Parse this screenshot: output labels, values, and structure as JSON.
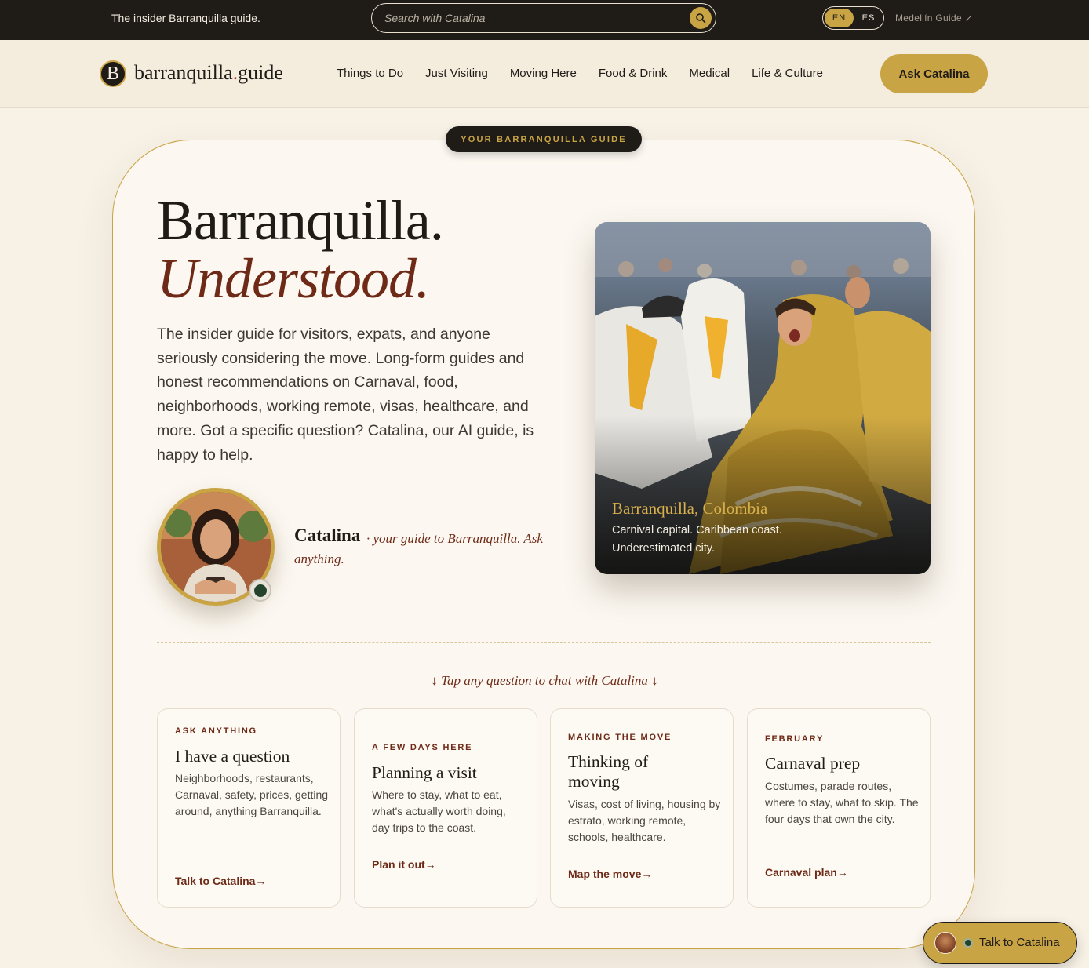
{
  "topbar": {
    "tagline": "The insider Barranquilla guide.",
    "search_placeholder": "Search with Catalina",
    "lang_en": "EN",
    "lang_es": "ES",
    "medellin_link": "Medellín Guide ↗"
  },
  "nav": {
    "logo_letter": "B",
    "logo_name": "barranquilla",
    "logo_dot": ".",
    "logo_suffix": "guide",
    "links": [
      "Things to Do",
      "Just Visiting",
      "Moving Here",
      "Food & Drink",
      "Medical",
      "Life & Culture"
    ],
    "cta": "Ask Catalina"
  },
  "hero": {
    "pill": "YOUR BARRANQUILLA GUIDE",
    "title_line1": "Barranquilla.",
    "title_line2": "Understood.",
    "intro": "The insider guide for visitors, expats, and anyone seriously considering the move. Long-form guides and honest recommendations on Carnaval, food, neighborhoods, working remote, visas, healthcare, and more. Got a specific question? Catalina, our AI guide, is happy to help.",
    "guide_name": "Catalina",
    "guide_sub": "· your guide to Barranquilla. Ask anything.",
    "image_caption_title": "Barranquilla, Colombia",
    "image_caption_text": "Carnival capital. Caribbean coast. Underestimated city."
  },
  "questions": {
    "prompt": "↓ Tap any question to chat with Catalina ↓",
    "cards": [
      {
        "eyebrow": "ASK ANYTHING",
        "title": "I have a question",
        "desc": "Neighborhoods, restaurants, Carnaval, safety, prices, getting around, anything Barranquilla.",
        "link": "Talk to Catalina→"
      },
      {
        "eyebrow": "A FEW DAYS HERE",
        "title": "Planning a visit",
        "desc": "Where to stay, what to eat, what's actually worth doing, day trips to the coast.",
        "link": "Plan it out→"
      },
      {
        "eyebrow": "MAKING THE MOVE",
        "title": "Thinking of moving",
        "desc": "Visas, cost of living, housing by estrato, working remote, schools, healthcare.",
        "link": "Map the move→"
      },
      {
        "eyebrow": "FEBRUARY",
        "title": "Carnaval prep",
        "desc": "Costumes, parade routes, where to stay, what to skip. The four days that own the city.",
        "link": "Carnaval plan→"
      }
    ]
  },
  "floating": {
    "label": "Talk to Catalina"
  },
  "colors": {
    "accent_gold": "#c9a445",
    "dark": "#1f1b17",
    "maroon": "#6e2a17",
    "cream": "#fcf8f1"
  }
}
